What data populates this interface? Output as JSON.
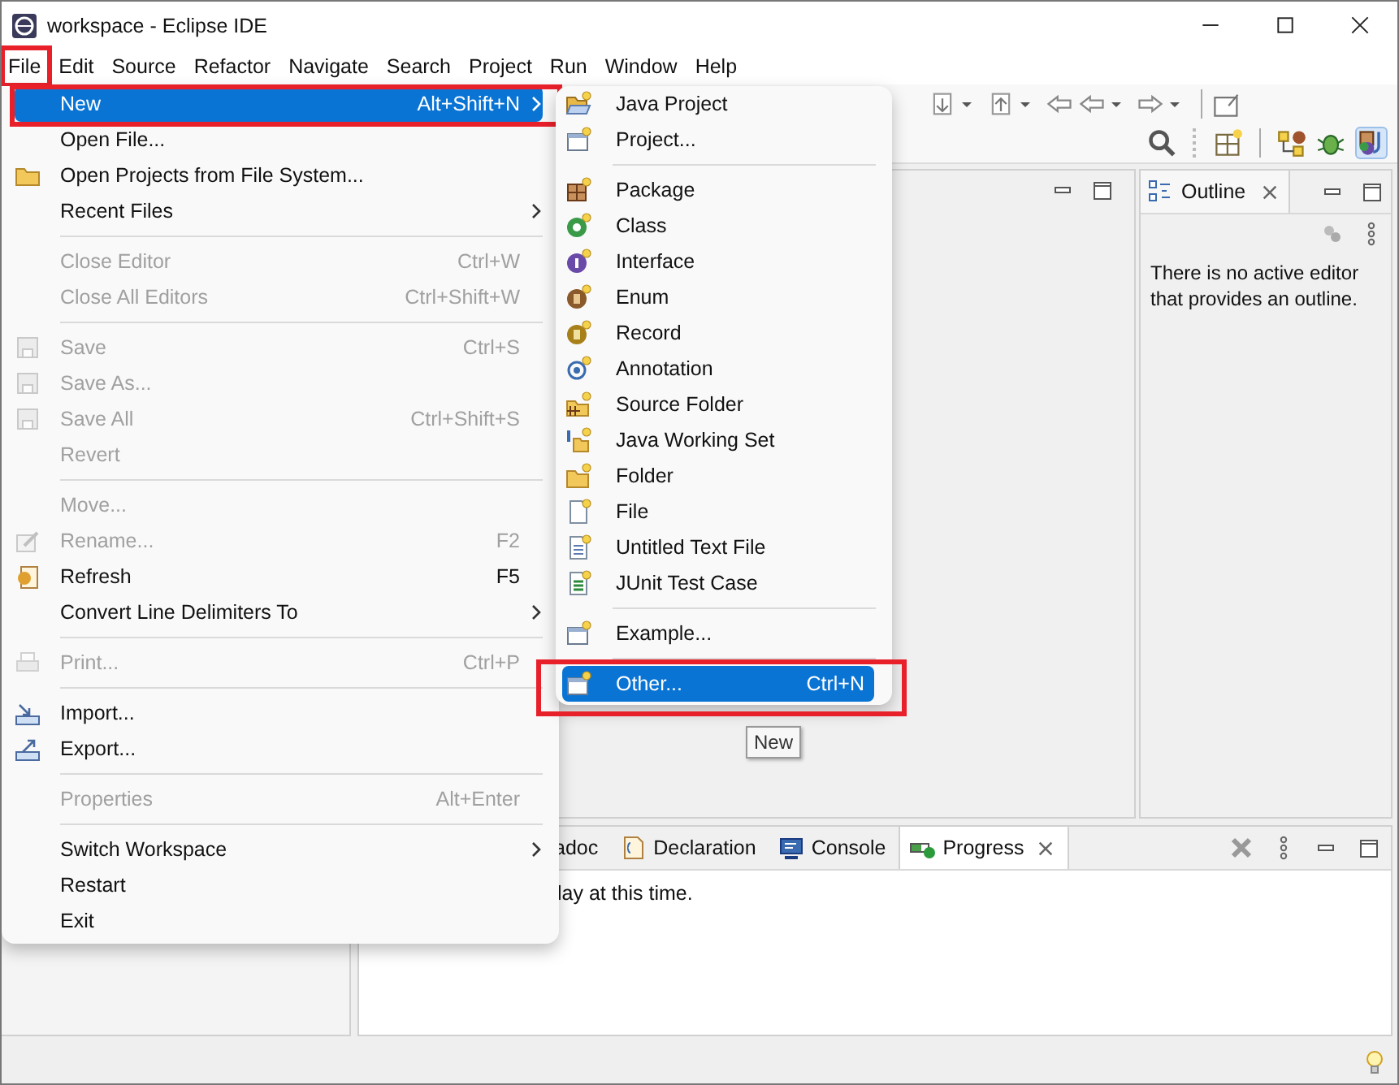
{
  "window": {
    "title": "workspace - Eclipse IDE"
  },
  "menubar": [
    {
      "label": "File",
      "highlighted": true
    },
    {
      "label": "Edit",
      "highlighted": false
    },
    {
      "label": "Source",
      "highlighted": false
    },
    {
      "label": "Refactor",
      "highlighted": false
    },
    {
      "label": "Navigate",
      "highlighted": false
    },
    {
      "label": "Search",
      "highlighted": false
    },
    {
      "label": "Project",
      "highlighted": false
    },
    {
      "label": "Run",
      "highlighted": false
    },
    {
      "label": "Window",
      "highlighted": false
    },
    {
      "label": "Help",
      "highlighted": false
    }
  ],
  "file_menu": {
    "items": [
      {
        "kind": "item",
        "label": "New",
        "shortcut": "Alt+Shift+N",
        "submenu": true,
        "disabled": false,
        "selected": true,
        "highlighted": true
      },
      {
        "kind": "item",
        "label": "Open File...",
        "submenu": false,
        "disabled": false,
        "selected": false,
        "highlighted": false
      },
      {
        "kind": "item",
        "label": "Open Projects from File System...",
        "submenu": false,
        "disabled": false,
        "selected": false,
        "highlighted": false
      },
      {
        "kind": "item",
        "label": "Recent Files",
        "submenu": true,
        "disabled": false,
        "selected": false,
        "highlighted": false
      },
      {
        "kind": "separator"
      },
      {
        "kind": "item",
        "label": "Close Editor",
        "shortcut": "Ctrl+W",
        "submenu": false,
        "disabled": true,
        "selected": false,
        "highlighted": false
      },
      {
        "kind": "item",
        "label": "Close All Editors",
        "shortcut": "Ctrl+Shift+W",
        "submenu": false,
        "disabled": true,
        "selected": false,
        "highlighted": false
      },
      {
        "kind": "separator"
      },
      {
        "kind": "item",
        "label": "Save",
        "shortcut": "Ctrl+S",
        "submenu": false,
        "disabled": true,
        "selected": false,
        "highlighted": false
      },
      {
        "kind": "item",
        "label": "Save As...",
        "submenu": false,
        "disabled": true,
        "selected": false,
        "highlighted": false
      },
      {
        "kind": "item",
        "label": "Save All",
        "shortcut": "Ctrl+Shift+S",
        "submenu": false,
        "disabled": true,
        "selected": false,
        "highlighted": false
      },
      {
        "kind": "item",
        "label": "Revert",
        "submenu": false,
        "disabled": true,
        "selected": false,
        "highlighted": false
      },
      {
        "kind": "separator"
      },
      {
        "kind": "item",
        "label": "Move...",
        "submenu": false,
        "disabled": true,
        "selected": false,
        "highlighted": false
      },
      {
        "kind": "item",
        "label": "Rename...",
        "shortcut": "F2",
        "submenu": false,
        "disabled": true,
        "selected": false,
        "highlighted": false
      },
      {
        "kind": "item",
        "label": "Refresh",
        "shortcut": "F5",
        "submenu": false,
        "disabled": false,
        "selected": false,
        "highlighted": false
      },
      {
        "kind": "item",
        "label": "Convert Line Delimiters To",
        "submenu": true,
        "disabled": false,
        "selected": false,
        "highlighted": false
      },
      {
        "kind": "separator"
      },
      {
        "kind": "item",
        "label": "Print...",
        "shortcut": "Ctrl+P",
        "submenu": false,
        "disabled": true,
        "selected": false,
        "highlighted": false
      },
      {
        "kind": "separator"
      },
      {
        "kind": "item",
        "label": "Import...",
        "submenu": false,
        "disabled": false,
        "selected": false,
        "highlighted": false
      },
      {
        "kind": "item",
        "label": "Export...",
        "submenu": false,
        "disabled": false,
        "selected": false,
        "highlighted": false
      },
      {
        "kind": "separator"
      },
      {
        "kind": "item",
        "label": "Properties",
        "shortcut": "Alt+Enter",
        "submenu": false,
        "disabled": true,
        "selected": false,
        "highlighted": false
      },
      {
        "kind": "separator"
      },
      {
        "kind": "item",
        "label": "Switch Workspace",
        "submenu": true,
        "disabled": false,
        "selected": false,
        "highlighted": false
      },
      {
        "kind": "item",
        "label": "Restart",
        "submenu": false,
        "disabled": false,
        "selected": false,
        "highlighted": false
      },
      {
        "kind": "item",
        "label": "Exit",
        "submenu": false,
        "disabled": false,
        "selected": false,
        "highlighted": false
      }
    ]
  },
  "new_submenu": {
    "items": [
      {
        "kind": "item",
        "label": "Java Project",
        "selected": false,
        "highlighted": false
      },
      {
        "kind": "item",
        "label": "Project...",
        "selected": false,
        "highlighted": false
      },
      {
        "kind": "separator"
      },
      {
        "kind": "item",
        "label": "Package",
        "selected": false,
        "highlighted": false
      },
      {
        "kind": "item",
        "label": "Class",
        "selected": false,
        "highlighted": false
      },
      {
        "kind": "item",
        "label": "Interface",
        "selected": false,
        "highlighted": false
      },
      {
        "kind": "item",
        "label": "Enum",
        "selected": false,
        "highlighted": false
      },
      {
        "kind": "item",
        "label": "Record",
        "selected": false,
        "highlighted": false
      },
      {
        "kind": "item",
        "label": "Annotation",
        "selected": false,
        "highlighted": false
      },
      {
        "kind": "item",
        "label": "Source Folder",
        "selected": false,
        "highlighted": false
      },
      {
        "kind": "item",
        "label": "Java Working Set",
        "selected": false,
        "highlighted": false
      },
      {
        "kind": "item",
        "label": "Folder",
        "selected": false,
        "highlighted": false
      },
      {
        "kind": "item",
        "label": "File",
        "selected": false,
        "highlighted": false
      },
      {
        "kind": "item",
        "label": "Untitled Text File",
        "selected": false,
        "highlighted": false
      },
      {
        "kind": "item",
        "label": "JUnit Test Case",
        "selected": false,
        "highlighted": false
      },
      {
        "kind": "separator"
      },
      {
        "kind": "item",
        "label": "Example...",
        "selected": false,
        "highlighted": false
      },
      {
        "kind": "separator"
      },
      {
        "kind": "item",
        "label": "Other...",
        "shortcut": "Ctrl+N",
        "selected": true,
        "highlighted": true
      }
    ]
  },
  "tooltip": "New",
  "outline": {
    "tab": "Outline",
    "message": "There is no active editor that provides an outline."
  },
  "bottom_panel": {
    "tabs": [
      {
        "label": "adoc",
        "selected": false
      },
      {
        "label": "Declaration",
        "selected": false
      },
      {
        "label": "Console",
        "selected": false
      },
      {
        "label": "Progress",
        "selected": true
      }
    ],
    "message": "lay at this time."
  }
}
